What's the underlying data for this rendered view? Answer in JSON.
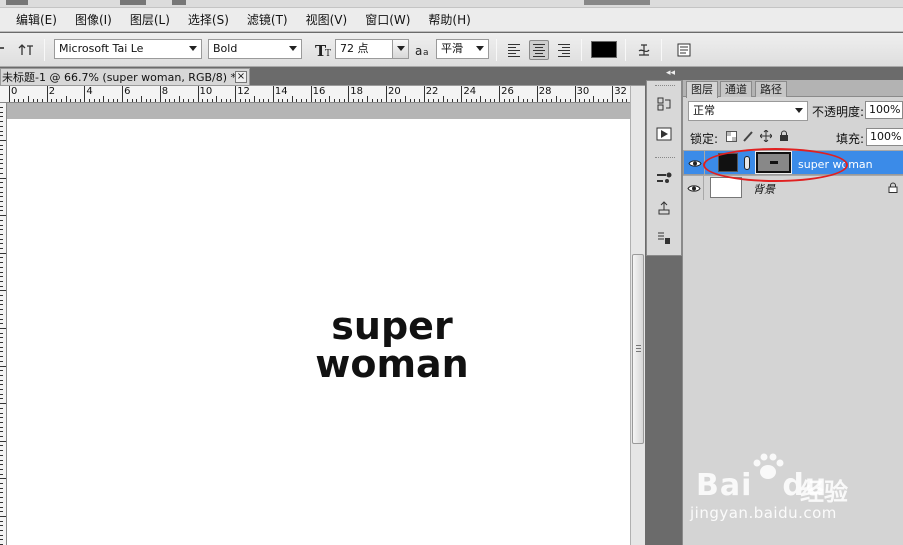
{
  "menu": [
    "编辑(E)",
    "图像(I)",
    "图层(L)",
    "选择(S)",
    "滤镜(T)",
    "视图(V)",
    "窗口(W)",
    "帮助(H)"
  ],
  "options": {
    "font_family": "Microsoft Tai Le",
    "font_style": "Bold",
    "font_size": "72 点",
    "antialias": "平滑",
    "color": "#000000"
  },
  "document": {
    "tab_title": "未标题-1 @ 66.7% (super woman, RGB/8) *",
    "close_label": "×",
    "ruler_labels": [
      "0",
      "2",
      "4",
      "6",
      "8",
      "10",
      "12",
      "14",
      "16",
      "18",
      "20",
      "22",
      "24",
      "26",
      "28",
      "30",
      "32"
    ],
    "text_line1": "super",
    "text_line2": "woman"
  },
  "layers_panel": {
    "tabs": [
      "图层",
      "通道",
      "路径"
    ],
    "blend_mode": "正常",
    "opacity_label": "不透明度:",
    "opacity_value": "100%",
    "lock_label": "锁定:",
    "fill_label": "填充:",
    "fill_value": "100%",
    "layers": [
      {
        "name": "super woman",
        "selected": true
      },
      {
        "name": "背景",
        "selected": false
      }
    ]
  },
  "watermark": {
    "brand": "Bai",
    "brand2": "du",
    "cn": "经验",
    "url": "jingyan.baidu.com"
  },
  "colors": {
    "selection": "#3b8be8",
    "highlight_oval": "#e02020"
  }
}
